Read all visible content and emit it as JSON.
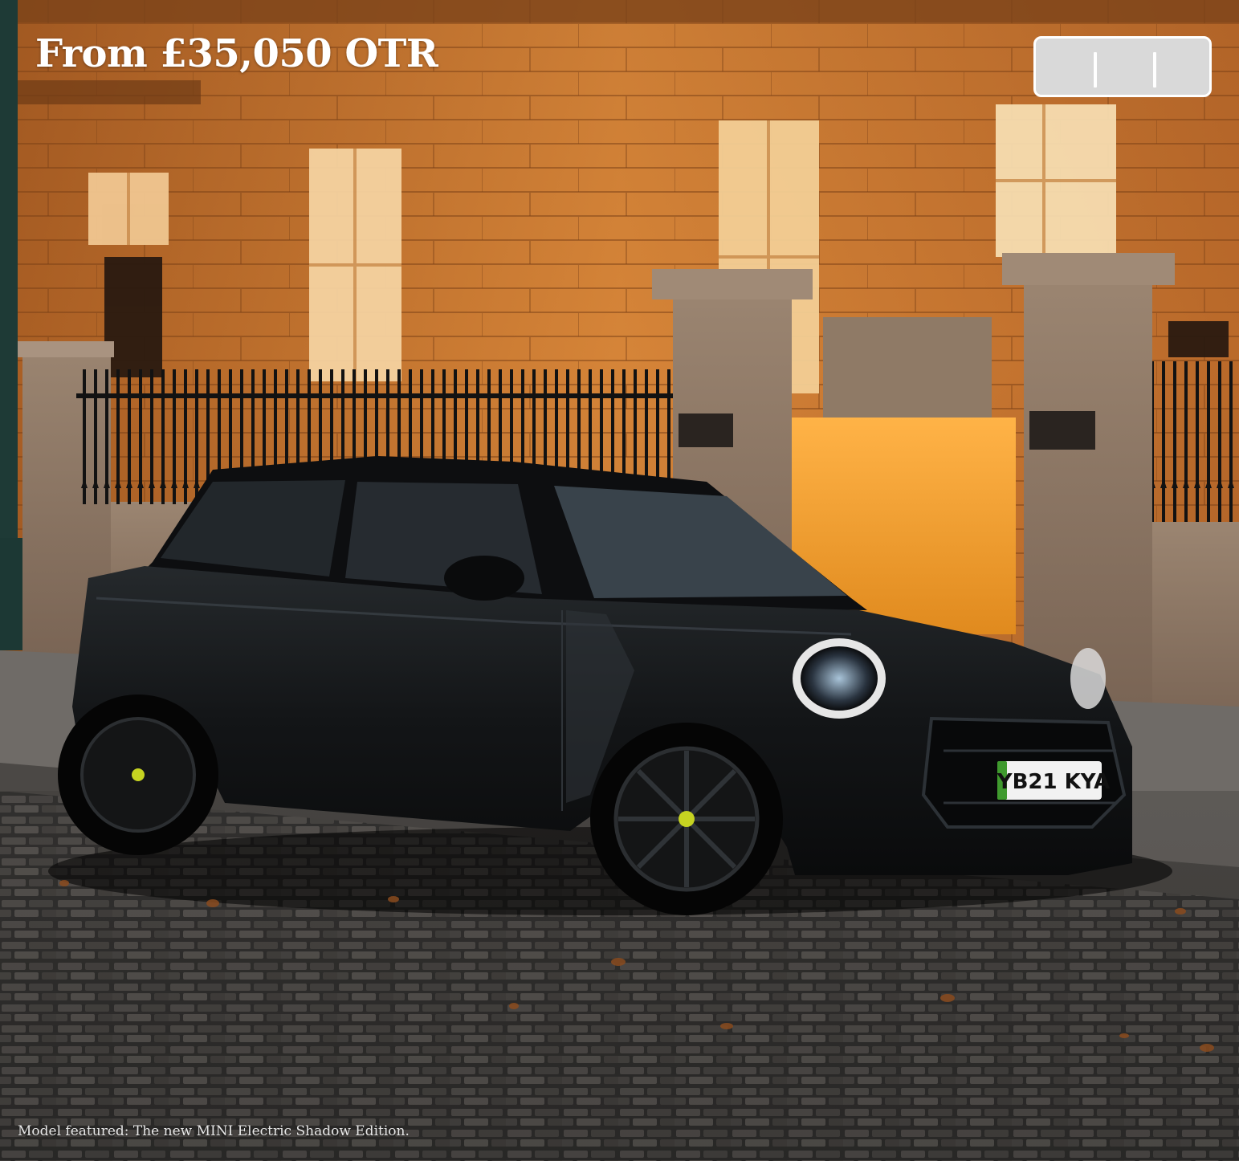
{
  "hero": {
    "price_text": "From £35,050 OTR",
    "caption": "Model featured: The new MINI Electric Shadow Edition.",
    "number_plate": "YB21 KYA"
  },
  "carousel_control": {
    "icon": "pause-icon"
  },
  "colors": {
    "price_text": "#ffffff",
    "control_background": "#d9d9d9",
    "control_border": "#ffffff",
    "car_body": "#141618",
    "plate_green_band": "#3f9a2e"
  }
}
